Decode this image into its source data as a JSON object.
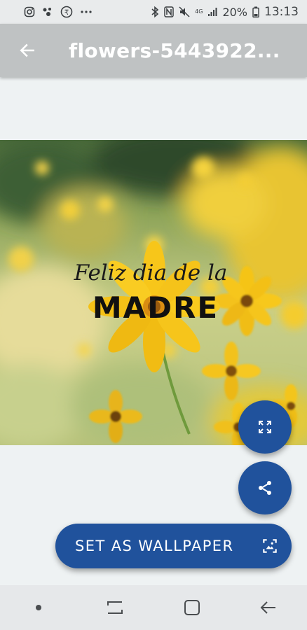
{
  "status_bar": {
    "battery_percent": "20%",
    "time": "13:13",
    "network_label": "4G"
  },
  "app_bar": {
    "title": "flowers-5443922..."
  },
  "image": {
    "script_text": "Feliz dia de la",
    "heading_text": "MADRE"
  },
  "actions": {
    "set_wallpaper_label": "SET AS WALLPAPER"
  },
  "colors": {
    "accent": "#20529c",
    "app_bar": "#bfc2c3",
    "background": "#eef2f3"
  }
}
